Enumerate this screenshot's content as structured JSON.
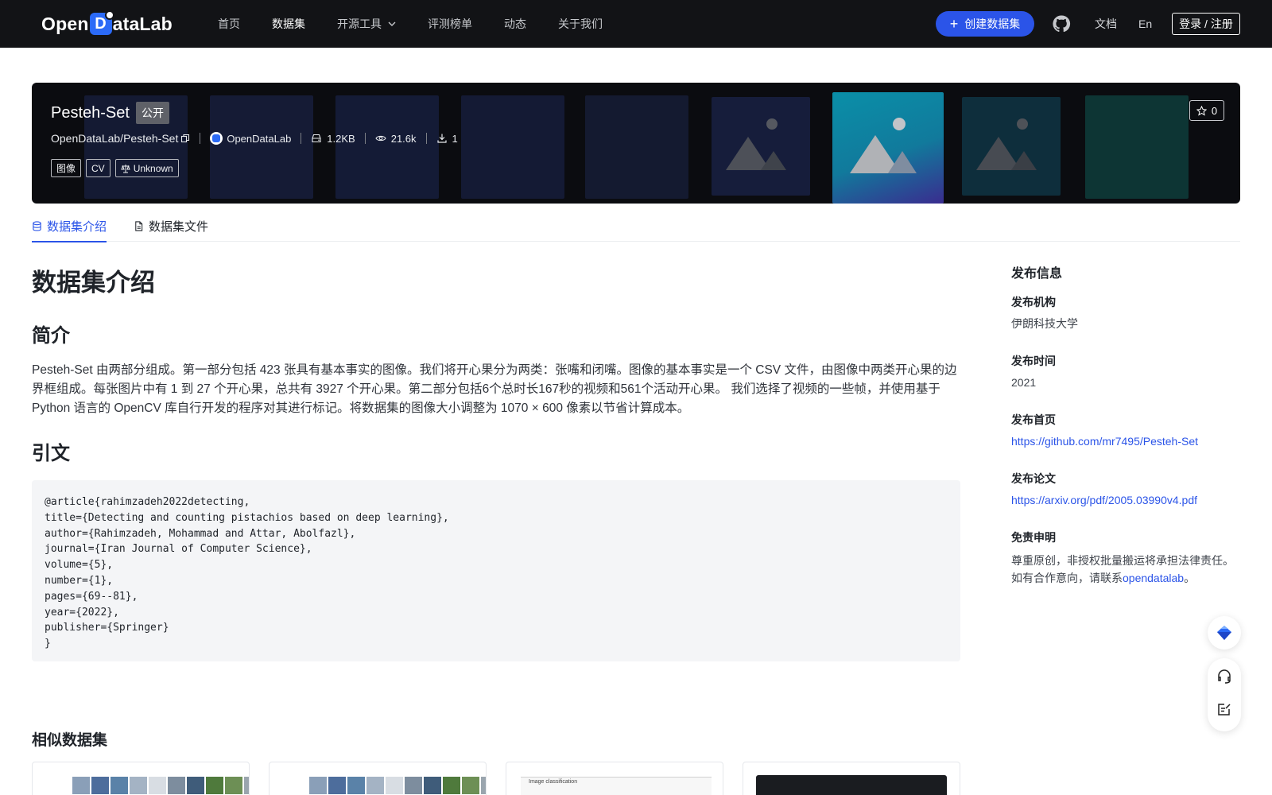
{
  "nav": {
    "logo": {
      "pre": "Open",
      "mark": "D",
      "post": "ataLab"
    },
    "links": [
      "首页",
      "数据集",
      "开源工具",
      "评测榜单",
      "动态",
      "关于我们"
    ],
    "active": "数据集",
    "create_label": "创建数据集",
    "docs": "文档",
    "lang": "En",
    "login": "登录 / 注册"
  },
  "banner": {
    "title": "Pesteh-Set",
    "visibility": "公开",
    "path": "OpenDataLab/Pesteh-Set",
    "org": "OpenDataLab",
    "size": "1.2KB",
    "views": "21.6k",
    "downloads": "1",
    "tags": [
      "图像",
      "CV"
    ],
    "license": "Unknown",
    "stars": "0"
  },
  "tabs": [
    "数据集介绍",
    "数据集文件"
  ],
  "main": {
    "heading": "数据集介绍",
    "intro_heading": "简介",
    "intro_text": "Pesteh-Set 由两部分组成。第一部分包括 423 张具有基本事实的图像。我们将开心果分为两类：张嘴和闭嘴。图像的基本事实是一个 CSV 文件，由图像中两类开心果的边界框组成。每张图片中有 1 到 27 个开心果，总共有 3927 个开心果。第二部分包括6个总时长167秒的视频和561个活动开心果。 我们选择了视频的一些帧，并使用基于 Python 语言的 OpenCV 库自行开发的程序对其进行标记。将数据集的图像大小调整为 1070 × 600 像素以节省计算成本。",
    "citation_heading": "引文",
    "citation": "@article{rahimzadeh2022detecting,\ntitle={Detecting and counting pistachios based on deep learning},\nauthor={Rahimzadeh, Mohammad and Attar, Abolfazl},\njournal={Iran Journal of Computer Science},\nvolume={5},\nnumber={1},\npages={69--81},\nyear={2022},\npublisher={Springer}\n}",
    "similar_heading": "相似数据集",
    "similar_card_text": [
      "Image classification"
    ]
  },
  "aside": {
    "title": "发布信息",
    "org_label": "发布机构",
    "org_value": "伊朗科技大学",
    "time_label": "发布时间",
    "time_value": "2021",
    "home_label": "发布首页",
    "home_value": "https://github.com/mr7495/Pesteh-Set",
    "paper_label": "发布论文",
    "paper_value": "https://arxiv.org/pdf/2005.03990v4.pdf",
    "disclaimer_label": "免责申明",
    "disclaimer_line1": "尊重原创，非授权批量搬运将承担法律责任。",
    "disclaimer_line2_pre": "如有合作意向，请联系",
    "disclaimer_link": "opendatalab",
    "disclaimer_line2_post": "。"
  },
  "colors": {
    "nav_bg": "#121316",
    "accent": "#2b54e8",
    "banner_bg": "#0b0c10",
    "code_bg": "#f4f5f7"
  }
}
